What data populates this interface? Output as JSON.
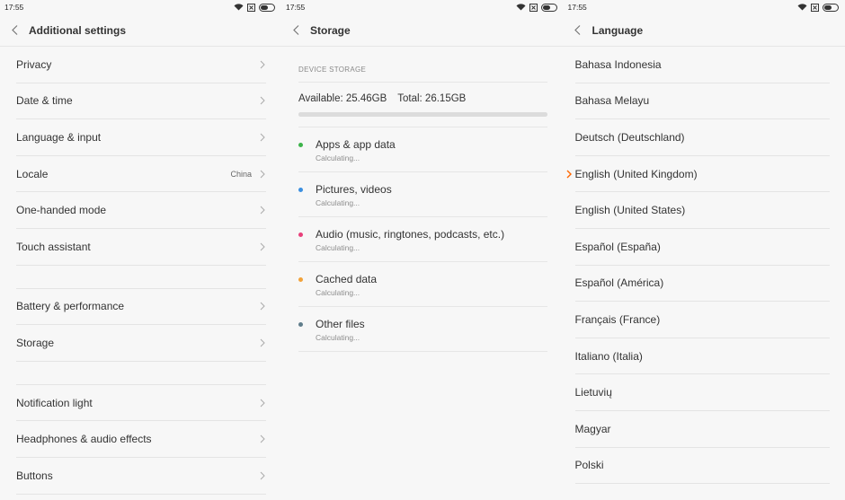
{
  "status": {
    "time": "17:55"
  },
  "colors": {
    "accent": "#ff6700",
    "dot_apps": "#3cb34a",
    "dot_pictures": "#3c8fe0",
    "dot_audio": "#e8407a",
    "dot_cached": "#f2a23a",
    "dot_other": "#607d8b"
  },
  "additional": {
    "title": "Additional settings",
    "rows": [
      {
        "label": "Privacy",
        "value": ""
      },
      {
        "label": "Date & time",
        "value": ""
      },
      {
        "label": "Language & input",
        "value": ""
      },
      {
        "label": "Locale",
        "value": "China"
      },
      {
        "label": "One-handed mode",
        "value": ""
      },
      {
        "label": "Touch assistant",
        "value": ""
      },
      {
        "label": "Battery & performance",
        "value": ""
      },
      {
        "label": "Storage",
        "value": ""
      },
      {
        "label": "Notification light",
        "value": ""
      },
      {
        "label": "Headphones & audio effects",
        "value": ""
      },
      {
        "label": "Buttons",
        "value": ""
      }
    ]
  },
  "storage": {
    "title": "Storage",
    "section_label": "DEVICE STORAGE",
    "available": "Available: 25.46GB",
    "total": "Total: 26.15GB",
    "categories": [
      {
        "name": "Apps & app data",
        "status": "Calculating..."
      },
      {
        "name": "Pictures, videos",
        "status": "Calculating..."
      },
      {
        "name": "Audio (music, ringtones, podcasts, etc.)",
        "status": "Calculating..."
      },
      {
        "name": "Cached data",
        "status": "Calculating..."
      },
      {
        "name": "Other files",
        "status": "Calculating..."
      }
    ]
  },
  "language": {
    "title": "Language",
    "selected": "English (United Kingdom)",
    "items": [
      "Bahasa Indonesia",
      "Bahasa Melayu",
      "Deutsch (Deutschland)",
      "English (United Kingdom)",
      "English (United States)",
      "Español (España)",
      "Español (América)",
      "Français (France)",
      "Italiano (Italia)",
      "Lietuvių",
      "Magyar",
      "Polski"
    ]
  }
}
